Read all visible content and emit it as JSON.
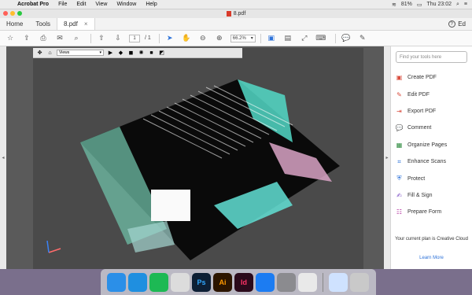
{
  "menubar": {
    "app": "Acrobat Pro",
    "items": [
      "File",
      "Edit",
      "View",
      "Window",
      "Help"
    ],
    "battery": "81%",
    "clock": "Thu 23:02"
  },
  "window": {
    "doc_title": "8.pdf"
  },
  "tabs": {
    "home": "Home",
    "tools": "Tools",
    "doc": "8.pdf",
    "close": "×",
    "help": "?",
    "user": "Ed"
  },
  "toolbar": {
    "page_current": "1",
    "page_total": "/ 1",
    "zoom": "66.2%"
  },
  "subtoolbar": {
    "views_label": "Views"
  },
  "tools_panel": {
    "search_placeholder": "Find your tools here",
    "items": [
      {
        "label": "Create PDF",
        "icon": "create-pdf-icon",
        "color": "#d94c3d"
      },
      {
        "label": "Edit PDF",
        "icon": "edit-pdf-icon",
        "color": "#d94c3d"
      },
      {
        "label": "Export PDF",
        "icon": "export-pdf-icon",
        "color": "#d94c3d"
      },
      {
        "label": "Comment",
        "icon": "comment-icon",
        "color": "#e0a800"
      },
      {
        "label": "Organize Pages",
        "icon": "organize-pages-icon",
        "color": "#2d8a3e"
      },
      {
        "label": "Enhance Scans",
        "icon": "enhance-scans-icon",
        "color": "#2d72d9"
      },
      {
        "label": "Protect",
        "icon": "protect-icon",
        "color": "#2d72d9"
      },
      {
        "label": "Fill & Sign",
        "icon": "fill-sign-icon",
        "color": "#7a4bc4"
      },
      {
        "label": "Prepare Form",
        "icon": "prepare-form-icon",
        "color": "#b73aa3"
      }
    ],
    "plan_text": "Your current plan is Creative Cloud",
    "learn_more": "Learn More"
  },
  "dock": {
    "apps": [
      {
        "name": "finder",
        "color": "#2b8fe8"
      },
      {
        "name": "safari",
        "color": "#1f8fe0"
      },
      {
        "name": "spotify",
        "color": "#1db954"
      },
      {
        "name": "preview-doc",
        "color": "#dcdcdc"
      },
      {
        "name": "photoshop",
        "label": "Ps",
        "color": "#0d1f35",
        "text": "#31a8ff"
      },
      {
        "name": "illustrator",
        "label": "Ai",
        "color": "#2c1500",
        "text": "#ff9a00"
      },
      {
        "name": "indesign",
        "label": "Id",
        "color": "#2b0a1b",
        "text": "#ff3366"
      },
      {
        "name": "app-store",
        "color": "#1c7cf2"
      },
      {
        "name": "system-preferences",
        "color": "#8b8b8f"
      },
      {
        "name": "acrobat",
        "color": "#e9e9e9"
      },
      {
        "name": "mail-preview",
        "color": "#cfe2ff"
      },
      {
        "name": "trash",
        "color": "#c9c9c9"
      }
    ]
  }
}
